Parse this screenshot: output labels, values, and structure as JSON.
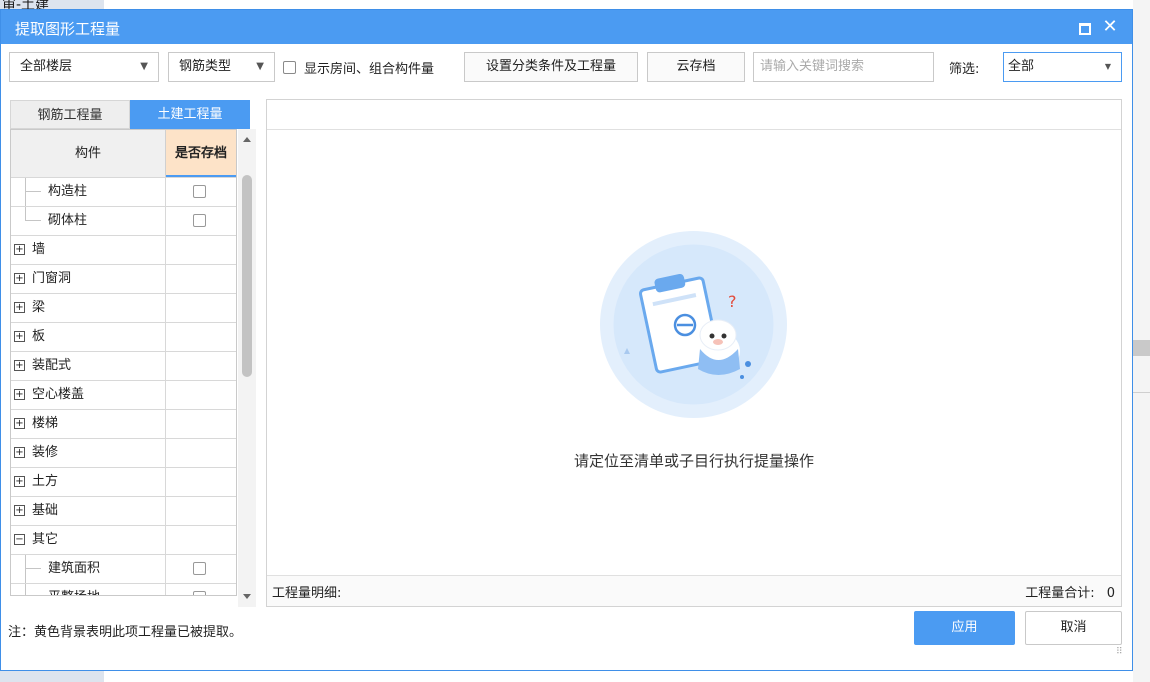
{
  "background": {
    "title_fragment": "审-土建"
  },
  "dialog": {
    "title": "提取图形工程量",
    "toolbar": {
      "floor_select": "全部楼层",
      "rebar_type_select": "钢筋类型",
      "show_rooms_label": "显示房间、组合构件量",
      "set_conditions_button": "设置分类条件及工程量",
      "cloud_archive_button": "云存档",
      "search_placeholder": "请输入关键词搜索",
      "filter_label": "筛选:",
      "filter_value": "全部"
    },
    "tabs": [
      {
        "label": "钢筋工程量",
        "active": false
      },
      {
        "label": "土建工程量",
        "active": true
      }
    ],
    "tree": {
      "col_component": "构件",
      "col_archived": "是否存档",
      "rows": [
        {
          "label": "构造柱",
          "type": "child",
          "checkbox": true
        },
        {
          "label": "砌体柱",
          "type": "child",
          "checkbox": true
        },
        {
          "label": "墙",
          "type": "parent",
          "expander": "+"
        },
        {
          "label": "门窗洞",
          "type": "parent",
          "expander": "+"
        },
        {
          "label": "梁",
          "type": "parent",
          "expander": "+"
        },
        {
          "label": "板",
          "type": "parent",
          "expander": "+"
        },
        {
          "label": "装配式",
          "type": "parent",
          "expander": "+"
        },
        {
          "label": "空心楼盖",
          "type": "parent",
          "expander": "+"
        },
        {
          "label": "楼梯",
          "type": "parent",
          "expander": "+"
        },
        {
          "label": "装修",
          "type": "parent",
          "expander": "+"
        },
        {
          "label": "土方",
          "type": "parent",
          "expander": "+"
        },
        {
          "label": "基础",
          "type": "parent",
          "expander": "+"
        },
        {
          "label": "其它",
          "type": "parent",
          "expander": "−"
        },
        {
          "label": "建筑面积",
          "type": "child",
          "checkbox": true
        },
        {
          "label": "平整场地",
          "type": "child",
          "checkbox": true
        }
      ]
    },
    "right_panel": {
      "empty_message": "请定位至清单或子目行执行提量操作",
      "detail_label": "工程量明细:",
      "total_label": "工程量合计:",
      "total_value": "0"
    },
    "footer": {
      "note": "注：黄色背景表明此项工程量已被提取。",
      "apply_button": "应用",
      "cancel_button": "取消"
    },
    "colors": {
      "accent": "#4b9bf2",
      "archived_header": "#fde3c8"
    }
  }
}
